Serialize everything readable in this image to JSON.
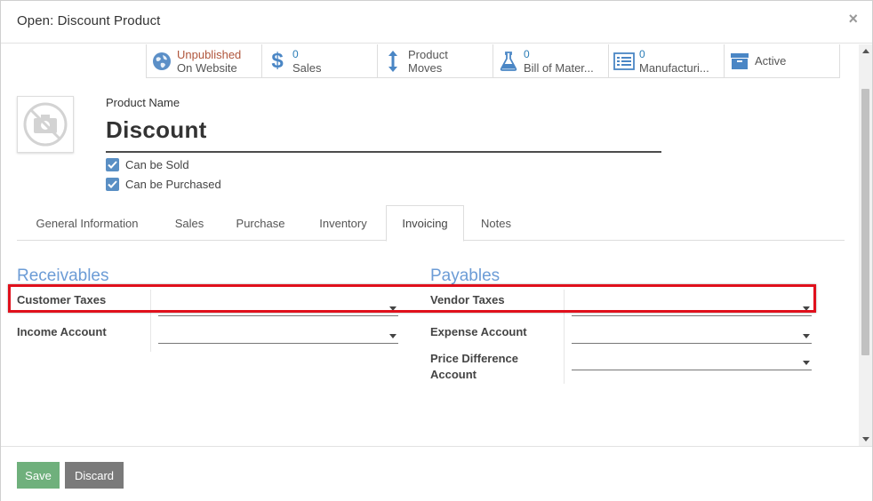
{
  "dialog": {
    "title": "Open: Discount Product",
    "close_label": "×"
  },
  "smart_buttons": [
    {
      "icon": "globe-icon",
      "line1": "Unpublished",
      "line2": "On Website"
    },
    {
      "icon": "dollar-icon",
      "line1": "0",
      "line2": "Sales"
    },
    {
      "icon": "arrows-vertical-icon",
      "line1": "Product",
      "line2": "Moves"
    },
    {
      "icon": "flask-icon",
      "line1": "0",
      "line2": "Bill of Mater..."
    },
    {
      "icon": "list-icon",
      "line1": "0",
      "line2": "Manufacturi..."
    },
    {
      "icon": "archive-icon",
      "line1": "Active",
      "line2": ""
    }
  ],
  "product": {
    "name_label": "Product Name",
    "name": "Discount",
    "can_be_sold_label": "Can be Sold",
    "can_be_sold": true,
    "can_be_purchased_label": "Can be Purchased",
    "can_be_purchased": true
  },
  "tabs": [
    {
      "label": "General Information",
      "active": false
    },
    {
      "label": "Sales",
      "active": false
    },
    {
      "label": "Purchase",
      "active": false
    },
    {
      "label": "Inventory",
      "active": false
    },
    {
      "label": "Invoicing",
      "active": true
    },
    {
      "label": "Notes",
      "active": false
    }
  ],
  "receivables": {
    "title": "Receivables",
    "customer_taxes_label": "Customer Taxes",
    "customer_taxes_value": "",
    "income_account_label": "Income Account",
    "income_account_value": ""
  },
  "payables": {
    "title": "Payables",
    "vendor_taxes_label": "Vendor Taxes",
    "vendor_taxes_value": "",
    "expense_account_label": "Expense Account",
    "expense_account_value": "",
    "price_diff_label_1": "Price Difference",
    "price_diff_label_2": "Account",
    "price_diff_value": ""
  },
  "footer": {
    "save_label": "Save",
    "discard_label": "Discard"
  },
  "colors": {
    "accent_blue": "#6c9cd6",
    "highlight_red": "#e0101c",
    "save_green": "#6fb07c",
    "discard_gray": "#7a7a7a"
  }
}
